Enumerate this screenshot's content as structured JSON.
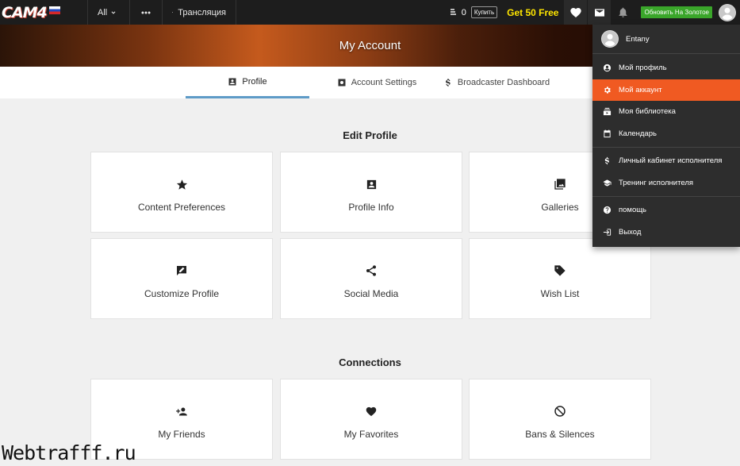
{
  "topbar": {
    "logo_text": "CAM4",
    "all_label": "All",
    "broadcast_label": "Трансляция",
    "tokens_count": "0",
    "buy_label": "Купить",
    "get_free_label": "Get 50 Free",
    "upgrade_label": "Обновить На Золотое"
  },
  "banner": {
    "title": "My Account"
  },
  "tabs": [
    {
      "label": "Profile"
    },
    {
      "label": "Account Settings"
    },
    {
      "label": "Broadcaster Dashboard"
    }
  ],
  "edit_profile": {
    "title": "Edit Profile",
    "cards": [
      {
        "label": "Content Preferences",
        "icon": "star-icon"
      },
      {
        "label": "Profile Info",
        "icon": "profile-card-icon"
      },
      {
        "label": "Galleries",
        "icon": "photo-library-icon"
      },
      {
        "label": "Customize Profile",
        "icon": "edit-box-icon"
      },
      {
        "label": "Social Media",
        "icon": "share-icon"
      },
      {
        "label": "Wish List",
        "icon": "tag-icon"
      }
    ]
  },
  "connections": {
    "title": "Connections",
    "cards": [
      {
        "label": "My Friends",
        "icon": "add-person-icon"
      },
      {
        "label": "My Favorites",
        "icon": "heart-icon"
      },
      {
        "label": "Bans & Silences",
        "icon": "block-icon"
      }
    ]
  },
  "dropdown": {
    "username": "Entany",
    "items": [
      {
        "label": "Мой профиль",
        "icon": "account-circle-icon"
      },
      {
        "label": "Мой аккаунт",
        "icon": "gear-icon",
        "active": true
      },
      {
        "label": "Моя библиотека",
        "icon": "library-icon"
      },
      {
        "label": "Календарь",
        "icon": "calendar-icon"
      },
      {
        "label": "Личный кабинет исполнителя",
        "icon": "dollar-icon"
      },
      {
        "label": "Тренинг исполнителя",
        "icon": "graduation-cap-icon"
      },
      {
        "label": "помощь",
        "icon": "help-icon"
      },
      {
        "label": "Выход",
        "icon": "logout-icon"
      }
    ]
  },
  "watermark": "Webtrafff.ru",
  "colors": {
    "accent_orange": "#f05a22",
    "tab_underline": "#5e9bc7",
    "upgrade_green": "#3aa62a",
    "free_yellow": "#ffe600"
  }
}
